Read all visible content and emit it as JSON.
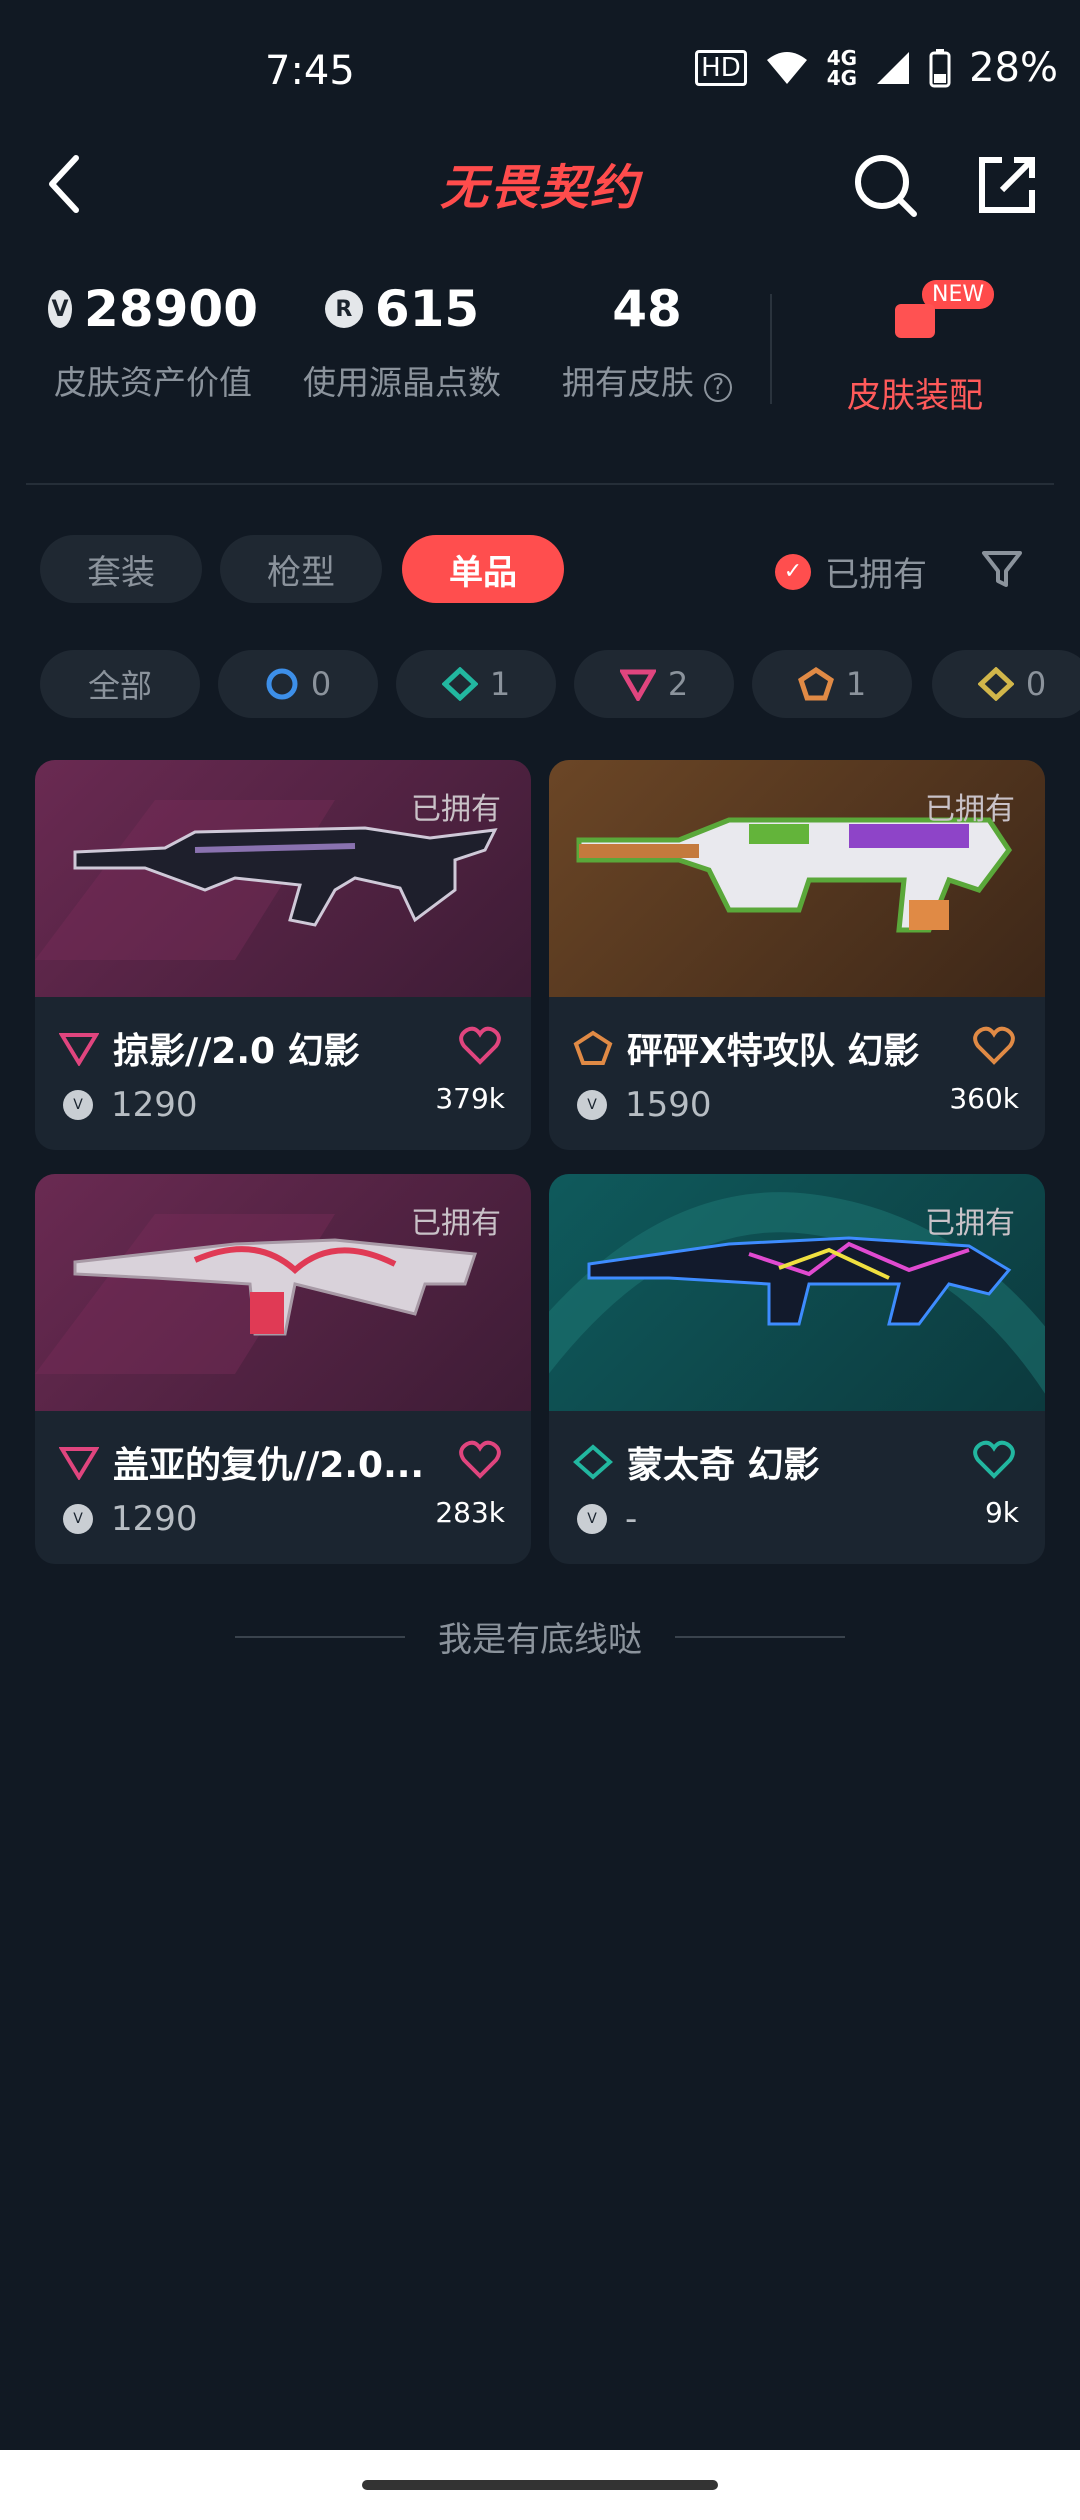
{
  "status": {
    "time": "7:45",
    "net_top": "4G",
    "net_bottom": "4G",
    "battery": "28%"
  },
  "header": {
    "title": "无畏契约"
  },
  "stats": {
    "asset_value": "28900",
    "asset_label": "皮肤资产价值",
    "points_used": "615",
    "points_label": "使用源晶点数",
    "skins_owned": "48",
    "skins_label": "拥有皮肤",
    "equip_label": "皮肤装配",
    "new_badge": "NEW"
  },
  "filters": {
    "tabs": [
      "套装",
      "枪型",
      "单品"
    ],
    "active_tab": "单品",
    "owned_label": "已拥有"
  },
  "tiers": {
    "all_label": "全部",
    "items": [
      {
        "icon": "circle-tier-icon",
        "count": "0",
        "color": "#3d8fe8"
      },
      {
        "icon": "diamond-tier-icon",
        "count": "1",
        "color": "#22b7a0"
      },
      {
        "icon": "triangle-tier-icon",
        "count": "2",
        "color": "#e0457e"
      },
      {
        "icon": "pentagon-tier-icon",
        "count": "1",
        "color": "#e08a45"
      },
      {
        "icon": "diamond-gold-tier-icon",
        "count": "0",
        "color": "#d1b64a"
      }
    ]
  },
  "skins": [
    {
      "name": "掠影//2.0 幻影",
      "owned": "已拥有",
      "price": "1290",
      "likes": "379k",
      "tier_color": "#e0457e",
      "bg": "#5a2646",
      "heart_color": "#e0457e"
    },
    {
      "name": "砰砰X特攻队 幻影",
      "owned": "已拥有",
      "price": "1590",
      "likes": "360k",
      "tier_color": "#e08a45",
      "bg": "#5a3a22",
      "heart_color": "#e08a45"
    },
    {
      "name": "盖亚的复仇//2.0...",
      "owned": "已拥有",
      "price": "1290",
      "likes": "283k",
      "tier_color": "#e0457e",
      "bg": "#5a2646",
      "heart_color": "#e0457e"
    },
    {
      "name": "蒙太奇 幻影",
      "owned": "已拥有",
      "price": "-",
      "likes": "9k",
      "tier_color": "#22b7a0",
      "bg": "#124a4c",
      "heart_color": "#22b7a0"
    }
  ],
  "footer": {
    "text": "我是有底线哒"
  },
  "colors": {
    "accent": "#ff4e4e",
    "background": "#111923",
    "card": "#1b2530"
  }
}
